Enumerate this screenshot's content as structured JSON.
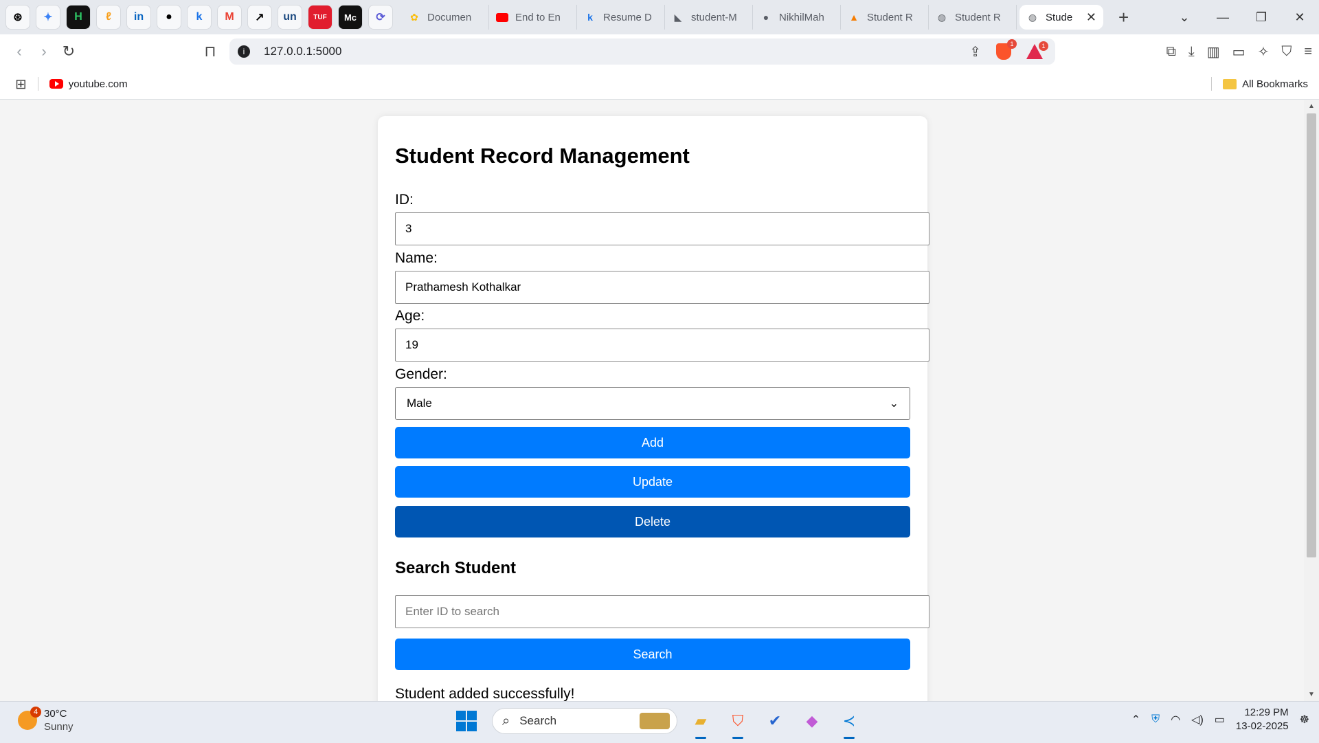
{
  "browser": {
    "pinned_tabs": [
      "⊛",
      "✦",
      "H",
      "ℓ",
      "in",
      "⌥",
      "k",
      "M",
      "↗",
      "un",
      "TUF",
      "Mc",
      "⟳"
    ],
    "tabs": [
      {
        "label": "Documen",
        "icon": "google-docs-icon"
      },
      {
        "label": "End to En",
        "icon": "youtube-icon"
      },
      {
        "label": "Resume D",
        "icon": "k-icon"
      },
      {
        "label": "student-M",
        "icon": "app-icon"
      },
      {
        "label": "NikhilMah",
        "icon": "github-icon"
      },
      {
        "label": "Student R",
        "icon": "fire-icon"
      },
      {
        "label": "Student R",
        "icon": "globe-icon"
      }
    ],
    "active_tab": {
      "label": "Stude",
      "close": "✕"
    },
    "new_tab": "+",
    "url": "127.0.0.1:5000",
    "brave_badge": "1",
    "rewards_badge": "1",
    "bookmark_youtube": "youtube.com",
    "all_bookmarks": "All Bookmarks"
  },
  "page": {
    "title": "Student Record Management",
    "id_label": "ID:",
    "id_value": "3",
    "name_label": "Name:",
    "name_value": "Prathamesh Kothalkar",
    "age_label": "Age:",
    "age_value": "19",
    "gender_label": "Gender:",
    "gender_value": "Male",
    "add_label": "Add",
    "update_label": "Update",
    "delete_label": "Delete",
    "search_heading": "Search Student",
    "search_placeholder": "Enter ID to search",
    "search_label": "Search",
    "message": "Student added successfully!",
    "colors": {
      "primary": "#007bff",
      "primary_hover": "#0056b3"
    }
  },
  "taskbar": {
    "weather_badge": "4",
    "temperature": "30°C",
    "condition": "Sunny",
    "search_placeholder": "Search",
    "time": "12:29 PM",
    "date": "13-02-2025"
  }
}
